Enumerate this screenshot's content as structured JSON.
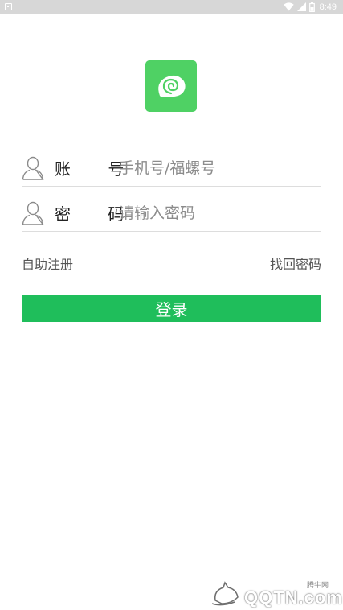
{
  "status_bar": {
    "time": "8:49",
    "icons": [
      "notification-icon",
      "wifi-icon",
      "signal-icon",
      "battery-icon"
    ]
  },
  "logo": {
    "icon": "snail-shell-icon",
    "color": "#4fd164"
  },
  "form": {
    "account": {
      "label": "账 号",
      "placeholder": "手机号/福螺号",
      "value": "",
      "icon": "user-icon"
    },
    "password": {
      "label": "密 码",
      "placeholder": "请输入密码",
      "value": "",
      "icon": "user-icon"
    }
  },
  "links": {
    "register": "自助注册",
    "forgot": "找回密码"
  },
  "login_button": {
    "label": "登录",
    "color": "#1fbe5b"
  },
  "watermark": {
    "small": "腾牛网",
    "main": "QQTN.com"
  }
}
